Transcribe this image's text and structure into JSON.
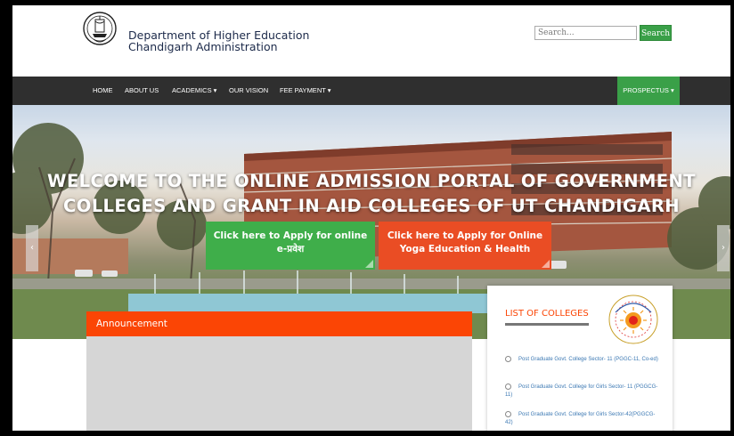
{
  "header": {
    "org_line1": "Department of Higher Education",
    "org_line2": "Chandigarh Administration",
    "search_placeholder": "Search...",
    "search_button": "Search"
  },
  "nav": {
    "items": [
      "HOME",
      "ABOUT US",
      "ACADEMICS ▾",
      "OUR VISION",
      "FEE PAYMENT ▾"
    ],
    "prospectus": "PROSPECTUS ▾"
  },
  "hero": {
    "title_line1": "WELCOME TO THE ONLINE ADMISSION PORTAL OF GOVERNMENT",
    "title_line2": "COLLEGES AND GRANT IN AID COLLEGES OF UT CHANDIGARH",
    "cta_apply_line1": "Click here to Apply for online",
    "cta_apply_line2": "e-प्रवेश",
    "cta_yoga_line1": "Click here to Apply for Online",
    "cta_yoga_line2": "Yoga Education & Health"
  },
  "announcement": {
    "title": "Announcement"
  },
  "colleges": {
    "title": "LIST OF COLLEGES",
    "items": [
      "Post Graduate Govt. College Sector- 11 (PGGC-11, Co-ed)",
      "Post Graduate Govt. College for Girls Sector- 11 (PGGCG-11)",
      "Post Graduate Govt. College for Girls Sector-42(PGGCG-42)"
    ]
  },
  "colors": {
    "nav_bg": "#2f2f2f",
    "accent_green": "#3aa048",
    "accent_orange": "#fb4505",
    "link_blue": "#3b78b3"
  },
  "icons": [
    "emblem-logo-icon",
    "chevron-left-icon",
    "chevron-right-icon",
    "college-seal-icon",
    "bullet-circle-icon"
  ]
}
